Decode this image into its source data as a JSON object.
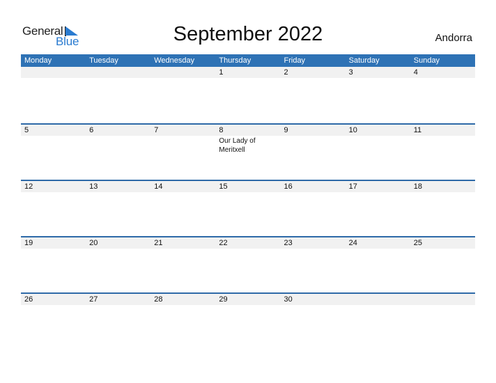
{
  "logo": {
    "general": "General",
    "blue": "Blue"
  },
  "title": "September 2022",
  "country": "Andorra",
  "weekdays": [
    "Monday",
    "Tuesday",
    "Wednesday",
    "Thursday",
    "Friday",
    "Saturday",
    "Sunday"
  ],
  "colors": {
    "header_bg": "#2e72b5",
    "accent": "#2a7bd0",
    "strip_bg": "#f1f1f1"
  },
  "weeks": [
    {
      "days": [
        "",
        "",
        "",
        "1",
        "2",
        "3",
        "4"
      ],
      "events": [
        "",
        "",
        "",
        "",
        "",
        "",
        ""
      ]
    },
    {
      "days": [
        "5",
        "6",
        "7",
        "8",
        "9",
        "10",
        "11"
      ],
      "events": [
        "",
        "",
        "",
        "Our Lady of Meritxell",
        "",
        "",
        ""
      ]
    },
    {
      "days": [
        "12",
        "13",
        "14",
        "15",
        "16",
        "17",
        "18"
      ],
      "events": [
        "",
        "",
        "",
        "",
        "",
        "",
        ""
      ]
    },
    {
      "days": [
        "19",
        "20",
        "21",
        "22",
        "23",
        "24",
        "25"
      ],
      "events": [
        "",
        "",
        "",
        "",
        "",
        "",
        ""
      ]
    },
    {
      "days": [
        "26",
        "27",
        "28",
        "29",
        "30",
        "",
        ""
      ],
      "events": [
        "",
        "",
        "",
        "",
        "",
        "",
        ""
      ]
    }
  ]
}
